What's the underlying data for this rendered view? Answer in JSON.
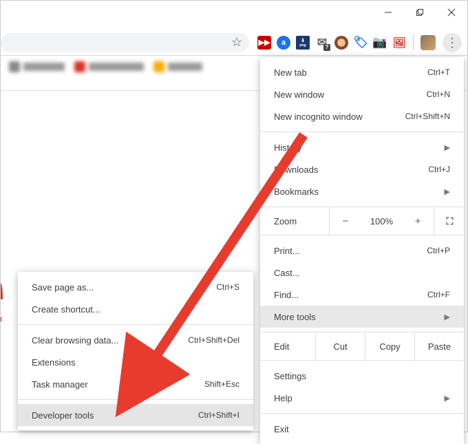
{
  "window_controls": {
    "minimize": "minimize",
    "maximize": "maximize",
    "close": "close"
  },
  "main_menu": {
    "items_a": [
      {
        "label": "New tab",
        "shortcut": "Ctrl+T"
      },
      {
        "label": "New window",
        "shortcut": "Ctrl+N"
      },
      {
        "label": "New incognito window",
        "shortcut": "Ctrl+Shift+N"
      }
    ],
    "items_b": [
      {
        "label": "History",
        "submenu": true
      },
      {
        "label": "Downloads",
        "shortcut": "Ctrl+J"
      },
      {
        "label": "Bookmarks",
        "submenu": true
      }
    ],
    "zoom": {
      "label": "Zoom",
      "minus": "−",
      "value": "100%",
      "plus": "+"
    },
    "items_c": [
      {
        "label": "Print...",
        "shortcut": "Ctrl+P"
      },
      {
        "label": "Cast..."
      },
      {
        "label": "Find...",
        "shortcut": "Ctrl+F"
      },
      {
        "label": "More tools",
        "submenu": true,
        "highlighted": true
      }
    ],
    "edit": {
      "label": "Edit",
      "cut": "Cut",
      "copy": "Copy",
      "paste": "Paste"
    },
    "items_d": [
      {
        "label": "Settings"
      },
      {
        "label": "Help",
        "submenu": true
      }
    ],
    "items_e": [
      {
        "label": "Exit"
      }
    ]
  },
  "sub_menu": {
    "items_a": [
      {
        "label": "Save page as...",
        "shortcut": "Ctrl+S"
      },
      {
        "label": "Create shortcut..."
      }
    ],
    "items_b": [
      {
        "label": "Clear browsing data...",
        "shortcut": "Ctrl+Shift+Del"
      },
      {
        "label": "Extensions"
      },
      {
        "label": "Task manager",
        "shortcut": "Shift+Esc"
      }
    ],
    "items_c": [
      {
        "label": "Developer tools",
        "shortcut": "Ctrl+Shift+I",
        "highlighted": true
      }
    ]
  },
  "extensions": [
    "gesture",
    "amazon",
    "png",
    "mail",
    "avatar-ext",
    "tag",
    "camera",
    "image"
  ],
  "colors": {
    "arrow": "#E83B2E",
    "menu_highlight": "#e5e5e5"
  }
}
